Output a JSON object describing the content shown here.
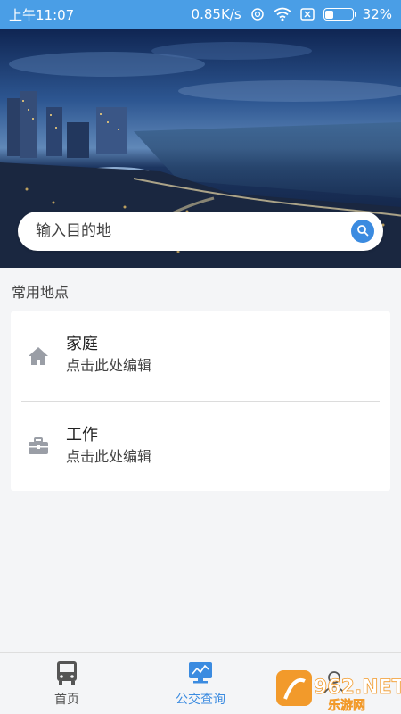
{
  "status_bar": {
    "time": "上午11:07",
    "network_speed": "0.85K/s",
    "battery_percent": "32%",
    "battery_level": 0.32,
    "icons": [
      "sync-icon",
      "wifi-icon",
      "sim-x-icon",
      "battery-icon"
    ]
  },
  "search": {
    "placeholder": "输入目的地",
    "icon": "search-icon"
  },
  "section": {
    "label": "常用地点"
  },
  "places": [
    {
      "title": "家庭",
      "subtitle": "点击此处编辑",
      "icon": "home-icon"
    },
    {
      "title": "工作",
      "subtitle": "点击此处编辑",
      "icon": "briefcase-icon"
    }
  ],
  "bottom_nav": {
    "items": [
      {
        "label": "首页",
        "icon": "bus-icon",
        "active": false
      },
      {
        "label": "公交查询",
        "icon": "monitor-icon",
        "active": true
      },
      {
        "label": "",
        "icon": "profile-icon",
        "active": false
      }
    ]
  },
  "watermark": {
    "text": "962.NET 乐游网"
  },
  "colors": {
    "accent": "#3b8be0",
    "status_bar": "#4a9ee6",
    "background": "#f4f5f7"
  }
}
